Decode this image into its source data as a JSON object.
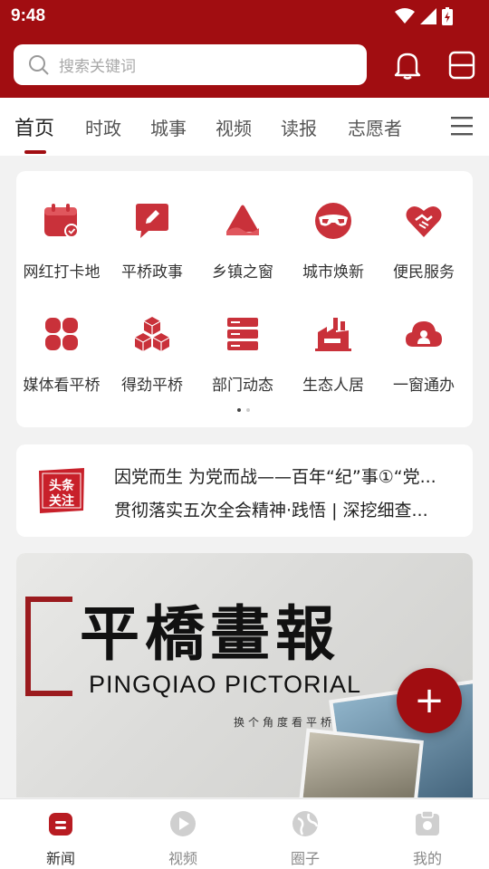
{
  "status_bar": {
    "time": "9:48"
  },
  "search": {
    "placeholder": "搜索关键词"
  },
  "tabs": [
    {
      "label": "首页",
      "active": true
    },
    {
      "label": "时政"
    },
    {
      "label": "城事"
    },
    {
      "label": "视频"
    },
    {
      "label": "读报"
    },
    {
      "label": "志愿者"
    }
  ],
  "grid": [
    {
      "label": "网红打卡地",
      "icon": "calendar-check-icon"
    },
    {
      "label": "平桥政事",
      "icon": "edit-chat-icon"
    },
    {
      "label": "乡镇之窗",
      "icon": "mountain-icon"
    },
    {
      "label": "城市焕新",
      "icon": "goggles-icon"
    },
    {
      "label": "便民服务",
      "icon": "heart-handshake-icon"
    },
    {
      "label": "媒体看平桥",
      "icon": "clover-icon"
    },
    {
      "label": "得劲平桥",
      "icon": "cubes-icon"
    },
    {
      "label": "部门动态",
      "icon": "server-icon"
    },
    {
      "label": "生态人居",
      "icon": "factory-icon"
    },
    {
      "label": "一窗通办",
      "icon": "cloud-user-icon"
    }
  ],
  "headline": {
    "badge_text": "头条关注",
    "lines": [
      "因党而生 为党而战——百年“纪”事①“党...",
      "贯彻落实五次全会精神·践悟 | 深挖细查..."
    ]
  },
  "banner": {
    "title_cn": "平橋畫報",
    "title_en": "PINGQIAO PICTORIAL",
    "subtitle": "换个角度看平桥"
  },
  "fab": {
    "label": "+"
  },
  "bottom_nav": [
    {
      "label": "新闻",
      "icon": "news-icon",
      "active": true
    },
    {
      "label": "视频",
      "icon": "play-icon"
    },
    {
      "label": "圈子",
      "icon": "globe-icon"
    },
    {
      "label": "我的",
      "icon": "profile-icon"
    }
  ],
  "colors": {
    "brand": "#a10d11",
    "icon_red": "#c9313a"
  }
}
